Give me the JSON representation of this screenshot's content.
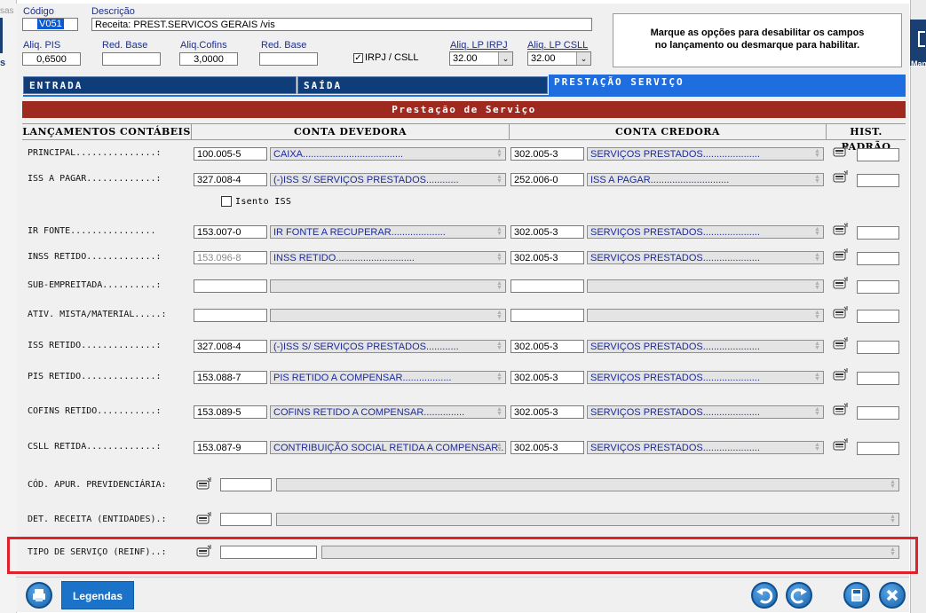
{
  "left_edge": {
    "top_text": "sas",
    "side_text": "s"
  },
  "right_edge": {
    "text": "Man"
  },
  "header": {
    "codigo_label": "Código",
    "codigo_value": "V051",
    "descricao_label": "Descrição",
    "descricao_value": "Receita: PREST.SERVICOS GERAIS /vis",
    "aliq_pis_label": "Aliq. PIS",
    "aliq_pis_value": "0,6500",
    "red_base1_label": "Red. Base",
    "red_base1_value": "",
    "aliq_cofins_label": "Aliq.Cofins",
    "aliq_cofins_value": "3,0000",
    "red_base2_label": "Red. Base",
    "red_base2_value": "",
    "irpj_csll_label": "IRPJ / CSLL",
    "irpj_csll_checked": true,
    "aliq_lp_irpj_label": "Aliq. LP IRPJ",
    "aliq_lp_irpj_value": "32.00",
    "aliq_lp_csll_label": "Aliq. LP CSLL",
    "aliq_lp_csll_value": "32.00",
    "info_text_1": "Marque as opções para desabilitar os campos",
    "info_text_2": "no lançamento ou desmarque para habilitar."
  },
  "tabs": [
    {
      "label": "ENTRADA",
      "active": false
    },
    {
      "label": "SAÍDA",
      "active": false
    },
    {
      "label": "PRESTAÇÃO SERVIÇO",
      "active": true
    }
  ],
  "section_title": "Prestação de Serviço",
  "columns": {
    "lancamentos": "LANÇAMENTOS CONTÁBEIS",
    "devedora": "CONTA DEVEDORA",
    "credora": "CONTA CREDORA",
    "hist": "HIST. PADRÃO"
  },
  "rows": [
    {
      "label": "PRINCIPAL...............:",
      "deb_code": "100.005-5",
      "deb_name": "CAIXA.....................................",
      "cred_code": "302.005-3",
      "cred_name": "SERVIÇOS PRESTADOS.....................",
      "hist": ""
    },
    {
      "label": "ISS A PAGAR.............:",
      "deb_code": "327.008-4",
      "deb_name": "(-)ISS S/ SERVIÇOS PRESTADOS............",
      "cred_code": "252.006-0",
      "cred_name": "ISS A PAGAR.............................",
      "hist": ""
    },
    {
      "label": "IR FONTE................",
      "deb_code": "153.007-0",
      "deb_name": "IR FONTE A RECUPERAR....................",
      "cred_code": "302.005-3",
      "cred_name": "SERVIÇOS PRESTADOS.....................",
      "hist": ""
    },
    {
      "label": "INSS RETIDO.............:",
      "deb_code": "153.096-8",
      "deb_name": "INSS RETIDO.............................",
      "cred_code": "302.005-3",
      "cred_name": "SERVIÇOS PRESTADOS.....................",
      "hist": ""
    },
    {
      "label": "SUB-EMPREITADA..........:",
      "deb_code": "",
      "deb_name": "",
      "cred_code": "",
      "cred_name": "",
      "hist": ""
    },
    {
      "label": "ATIV. MISTA/MATERIAL.....:",
      "deb_code": "",
      "deb_name": "",
      "cred_code": "",
      "cred_name": "",
      "hist": ""
    },
    {
      "label": "ISS RETIDO..............:",
      "deb_code": "327.008-4",
      "deb_name": "(-)ISS S/ SERVIÇOS PRESTADOS............",
      "cred_code": "302.005-3",
      "cred_name": "SERVIÇOS PRESTADOS.....................",
      "hist": ""
    },
    {
      "label": "PIS RETIDO..............:",
      "deb_code": "153.088-7",
      "deb_name": "PIS RETIDO A COMPENSAR..................",
      "cred_code": "302.005-3",
      "cred_name": "SERVIÇOS PRESTADOS.....................",
      "hist": ""
    },
    {
      "label": "COFINS RETIDO...........:",
      "deb_code": "153.089-5",
      "deb_name": "COFINS RETIDO A COMPENSAR...............",
      "cred_code": "302.005-3",
      "cred_name": "SERVIÇOS PRESTADOS.....................",
      "hist": ""
    },
    {
      "label": "CSLL RETIDA.............:",
      "deb_code": "153.087-9",
      "deb_name": "CONTRIBUIÇÃO SOCIAL RETIDA A COMPENSAR..",
      "cred_code": "302.005-3",
      "cred_name": "SERVIÇOS PRESTADOS.....................",
      "hist": ""
    }
  ],
  "isento_iss_label": "Isento ISS",
  "isento_iss_checked": false,
  "extra_rows": [
    {
      "label": "CÓD. APUR. PREVIDENCIÁRIA:",
      "code": "",
      "desc": ""
    },
    {
      "label": "DET. RECEITA (ENTIDADES).:",
      "code": "",
      "desc": ""
    },
    {
      "label": "TIPO DE SERVIÇO (REINF)..:",
      "code": "",
      "desc": ""
    }
  ],
  "footer": {
    "legendas_label": "Legendas"
  },
  "colors": {
    "tab_inactive": "#0f3d7a",
    "tab_active": "#1e6ee0",
    "section_bar": "#9e2a1f",
    "highlight": "#e0202a",
    "account_text": "#1b2a9c"
  },
  "icons": [
    "printer-icon",
    "undo-icon",
    "redo-icon",
    "save-icon",
    "close-icon",
    "history-lookup-icon"
  ]
}
